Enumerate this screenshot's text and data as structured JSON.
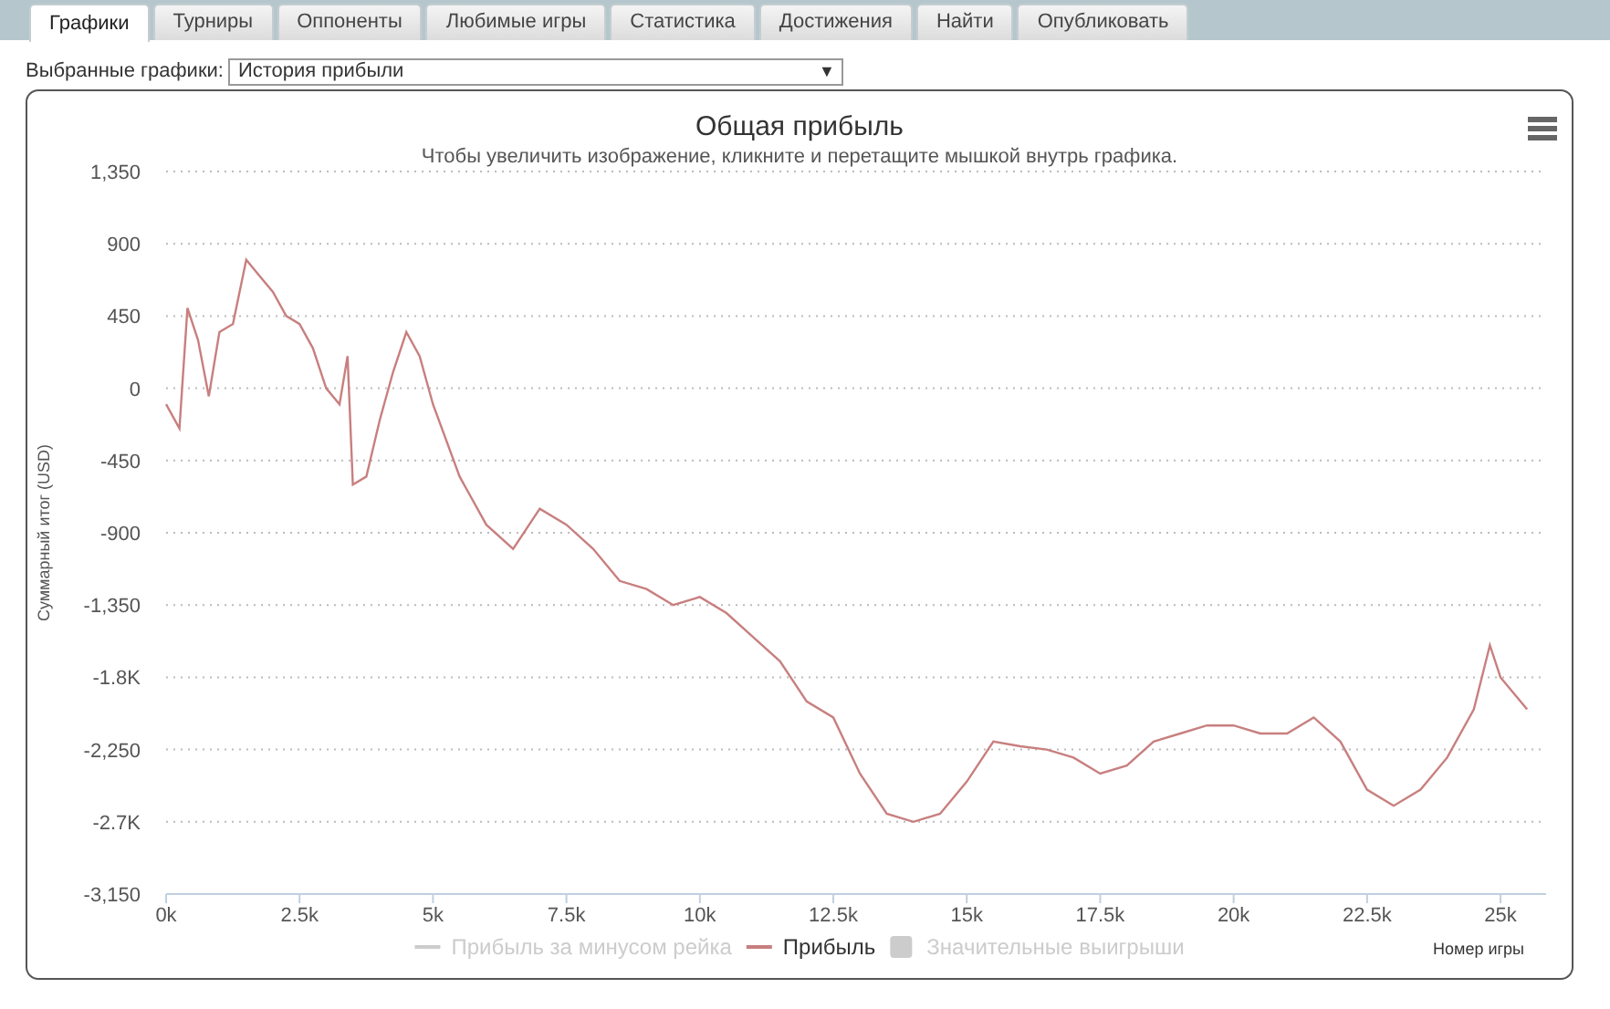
{
  "tabs": [
    {
      "label": "Графики",
      "selected": true
    },
    {
      "label": "Турниры",
      "selected": false
    },
    {
      "label": "Оппоненты",
      "selected": false
    },
    {
      "label": "Любимые игры",
      "selected": false
    },
    {
      "label": "Статистика",
      "selected": false
    },
    {
      "label": "Достижения",
      "selected": false
    },
    {
      "label": "Найти",
      "selected": false
    },
    {
      "label": "Опубликовать",
      "selected": false
    }
  ],
  "chart_selector": {
    "label": "Выбранные графики:",
    "value": "История прибыли",
    "arrow": "▼"
  },
  "chart": {
    "subtitle": "Чтобы увеличить изображение, кликните и перетащите мышкой внутрь графика.",
    "legend": [
      {
        "label": "Прибыль за минусом рейка",
        "kind": "line",
        "visible": false
      },
      {
        "kind": "series",
        "visible": true
      },
      {
        "label": "Значительные выигрыши",
        "kind": "square",
        "visible": false
      }
    ],
    "chart_data": {
      "type": "line",
      "title": "Общая прибыль",
      "xlabel": "Номер игры",
      "ylabel": "Суммарный итог (USD)",
      "x": [
        0,
        250,
        400,
        600,
        800,
        1000,
        1250,
        1500,
        1750,
        2000,
        2250,
        2500,
        2750,
        3000,
        3250,
        3400,
        3500,
        3750,
        4000,
        4250,
        4500,
        4750,
        5000,
        5500,
        6000,
        6500,
        7000,
        7500,
        8000,
        8500,
        9000,
        9500,
        10000,
        10500,
        11000,
        11500,
        12000,
        12500,
        13000,
        13500,
        14000,
        14500,
        15000,
        15500,
        16000,
        16500,
        17000,
        17500,
        18000,
        18500,
        19000,
        19500,
        20000,
        20500,
        21000,
        21500,
        22000,
        22500,
        23000,
        23500,
        24000,
        24500,
        24800,
        25000,
        25500
      ],
      "series": [
        {
          "name": "Прибыль",
          "color": "#c87f7f",
          "values": [
            -100,
            -250,
            500,
            300,
            -50,
            350,
            400,
            800,
            700,
            600,
            450,
            400,
            250,
            0,
            -100,
            200,
            -600,
            -550,
            -200,
            100,
            350,
            200,
            -100,
            -550,
            -850,
            -1000,
            -750,
            -850,
            -1000,
            -1200,
            -1250,
            -1350,
            -1300,
            -1400,
            -1550,
            -1700,
            -1950,
            -2050,
            -2400,
            -2650,
            -2700,
            -2650,
            -2450,
            -2200,
            -2230,
            -2250,
            -2300,
            -2400,
            -2350,
            -2200,
            -2150,
            -2100,
            -2100,
            -2150,
            -2150,
            -2050,
            -2200,
            -2500,
            -2600,
            -2500,
            -2300,
            -2000,
            -1600,
            -1800,
            -2000
          ]
        }
      ],
      "xlim": [
        0,
        25820
      ],
      "ylim": [
        -3150,
        1350
      ],
      "grid": true,
      "xticks": [
        {
          "value": 0,
          "label": "0k"
        },
        {
          "value": 2500,
          "label": "2.5k"
        },
        {
          "value": 5000,
          "label": "5k"
        },
        {
          "value": 7500,
          "label": "7.5k"
        },
        {
          "value": 10000,
          "label": "10k"
        },
        {
          "value": 12500,
          "label": "12.5k"
        },
        {
          "value": 15000,
          "label": "15k"
        },
        {
          "value": 17500,
          "label": "17.5k"
        },
        {
          "value": 20000,
          "label": "20k"
        },
        {
          "value": 22500,
          "label": "22.5k"
        },
        {
          "value": 25000,
          "label": "25k"
        }
      ],
      "yticks": [
        {
          "value": 1350,
          "label": "1,350"
        },
        {
          "value": 900,
          "label": "900"
        },
        {
          "value": 450,
          "label": "450"
        },
        {
          "value": 0,
          "label": "0"
        },
        {
          "value": -450,
          "label": "-450"
        },
        {
          "value": -900,
          "label": "-900"
        },
        {
          "value": -1350,
          "label": "-1,350"
        },
        {
          "value": -1800,
          "label": "-1.8K"
        },
        {
          "value": -2250,
          "label": "-2,250"
        },
        {
          "value": -2700,
          "label": "-2.7K"
        },
        {
          "value": -3150,
          "label": "-3,150"
        }
      ]
    }
  }
}
